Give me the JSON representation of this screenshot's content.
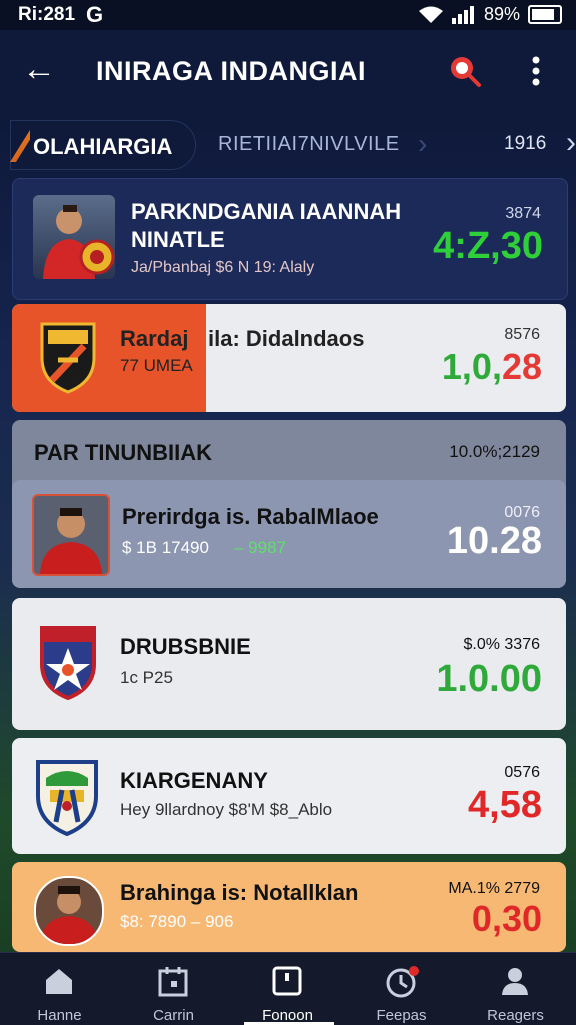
{
  "status_bar": {
    "time": "Ri:281",
    "google_badge": "G",
    "battery_text": "89%"
  },
  "app_bar": {
    "title": "INIRAGA INDANGIAI"
  },
  "tabs": {
    "active_label": "OLAHIARGIA",
    "second_label": "RIETIIAI7NIVLVILE",
    "count": "1916"
  },
  "cards": [
    {
      "name_line1": "PARKNDGANIA IAANNAH",
      "name_line2": "NINATLE",
      "subline": "Ja/Pbanbaj $6 N 19: Alaly",
      "small": "3874",
      "odds": "4:Z,30",
      "odds_color": "#2fcf3a"
    },
    {
      "name_left": "Rardaj",
      "name_right": "ila: Didalndaos",
      "sub": "77 UMEA",
      "small": "8576",
      "odds": "1,0,28",
      "odds_color": "#e53935",
      "accent": "#e8542a"
    },
    {
      "section_title": "PAR TINUNBIIAK",
      "section_right": "10.0%;2129",
      "name": "Prerirdga is. RabalMlaoe",
      "sub_left": "$ 1B 17490",
      "sub_right": "– 9987",
      "small": "0076",
      "odds": "10.28"
    },
    {
      "name": "DRUBSBNIE",
      "sub": "1c P25",
      "small": "$.0% 3376",
      "odds": "1.0.00",
      "odds_color": "#2faa3a"
    },
    {
      "name": "KIARGENANY",
      "sub": "Hey 9llardnoy $8'M $8_Ablo",
      "small": "0576",
      "odds": "4,58",
      "odds_color": "#e02828"
    },
    {
      "name": "Brahinga is: Notallklan",
      "sub": "$8: 7890 – 906",
      "small": "MA.1% 2779",
      "odds": "0,30",
      "odds_color": "#e02828"
    }
  ],
  "nav": [
    {
      "label": "Hanne",
      "icon": "home-icon"
    },
    {
      "label": "Carrin",
      "icon": "calendar-icon"
    },
    {
      "label": "Fonoon",
      "icon": "square-icon"
    },
    {
      "label": "Feepas",
      "icon": "clock-icon"
    },
    {
      "label": "Reagers",
      "icon": "person-icon"
    }
  ]
}
